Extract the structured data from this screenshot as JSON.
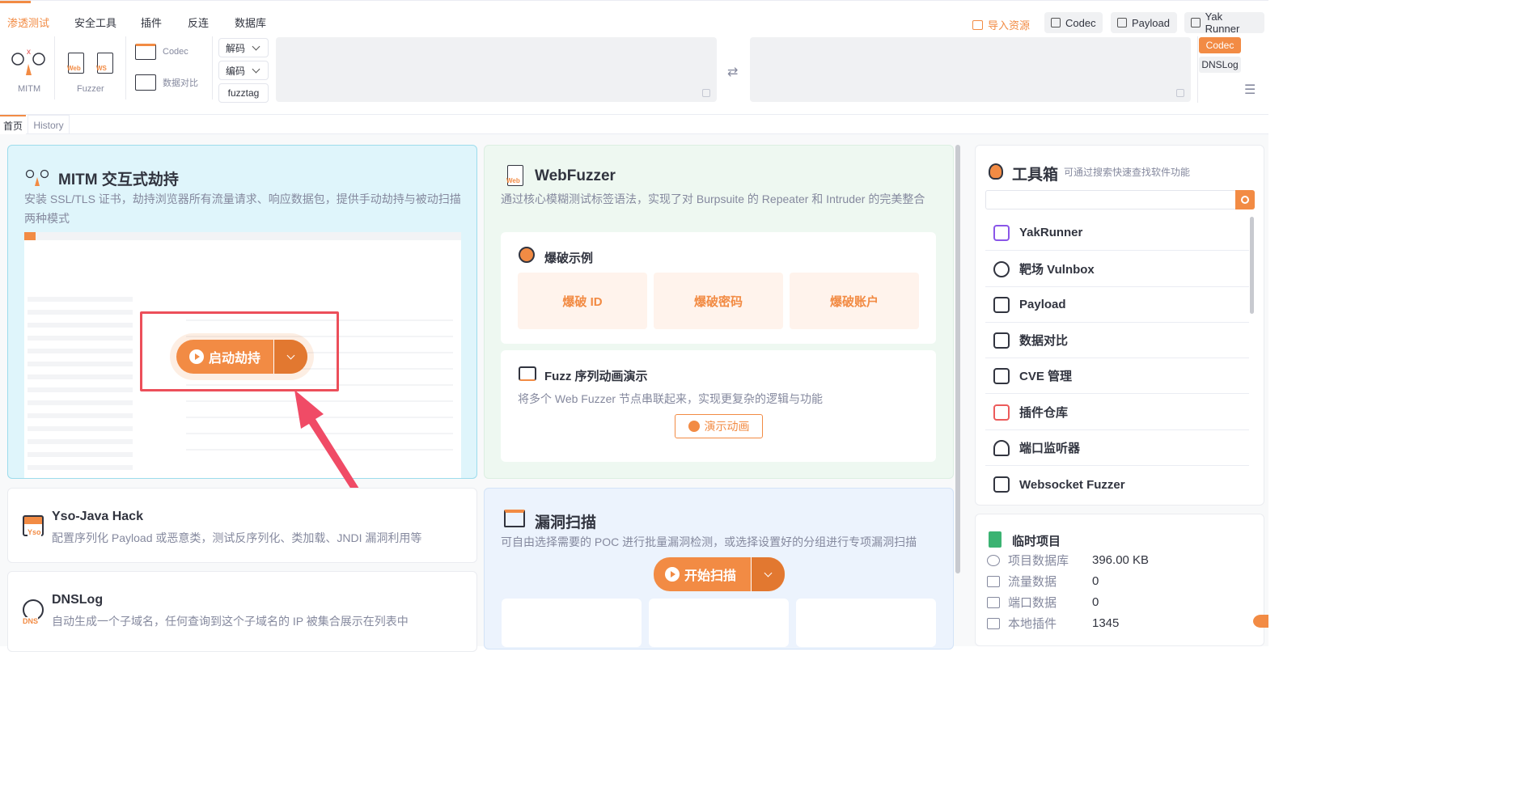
{
  "menubar": {
    "items": [
      "渗透测试",
      "安全工具",
      "插件",
      "反连",
      "数据库"
    ],
    "import_label": "导入资源",
    "right_buttons": [
      "Codec",
      "Payload",
      "Yak Runner"
    ]
  },
  "toolbar": {
    "mitm_label": "MITM",
    "fuzzer_label": "Fuzzer",
    "web_tag": "Web",
    "ws_tag": "WS",
    "codec_label": "Codec",
    "compare_label": "数据对比",
    "decode_label": "解码",
    "encode_label": "编码",
    "fuzztag_label": "fuzztag",
    "side_codec": "Codec",
    "side_dnslog": "DNSLog"
  },
  "tabs": [
    "首页",
    "History"
  ],
  "mitm": {
    "title": "MITM 交互式劫持",
    "desc": "安装 SSL/TLS 证书，劫持浏览器所有流量请求、响应数据包，提供手动劫持与被动扫描两种模式",
    "button": "启动劫持"
  },
  "webfuzzer": {
    "title": "WebFuzzer",
    "desc": "通过核心模糊测试标签语法，实现了对 Burpsuite 的 Repeater 和 Intruder 的完美整合",
    "examples_title": "爆破示例",
    "examples": [
      "爆破 ID",
      "爆破密码",
      "爆破账户"
    ],
    "anim_title": "Fuzz 序列动画演示",
    "anim_desc": "将多个 Web Fuzzer 节点串联起来，实现更复杂的逻辑与功能",
    "anim_button": "演示动画"
  },
  "yso": {
    "title": "Yso-Java Hack",
    "desc": "配置序列化 Payload 或恶意类，测试反序列化、类加载、JNDI 漏洞利用等",
    "tag": "Yso"
  },
  "dnslog": {
    "title": "DNSLog",
    "desc": "自动生成一个子域名，任何查询到这个子域名的 IP 被集合展示在列表中",
    "tag": "DNS"
  },
  "vulnscan": {
    "title": "漏洞扫描",
    "desc": "可自由选择需要的 POC 进行批量漏洞检测，或选择设置好的分组进行专项漏洞扫描",
    "button": "开始扫描"
  },
  "toolbox": {
    "title": "工具箱",
    "subtitle": "可通过搜索快速查找软件功能",
    "search_value": "",
    "items": [
      "YakRunner",
      "靶场 Vulnbox",
      "Payload",
      "数据对比",
      "CVE 管理",
      "插件仓库",
      "端口监听器",
      "Websocket Fuzzer"
    ],
    "colors": {
      "accent": "#f28b44",
      "yakrunner": "#8a56e8",
      "plugin_store": "#ec5b5b"
    }
  },
  "project": {
    "title": "临时项目",
    "stats": [
      {
        "label": "项目数据库",
        "value": "396.00 KB"
      },
      {
        "label": "流量数据",
        "value": "0"
      },
      {
        "label": "端口数据",
        "value": "0"
      },
      {
        "label": "本地插件",
        "value": "1345"
      }
    ]
  }
}
